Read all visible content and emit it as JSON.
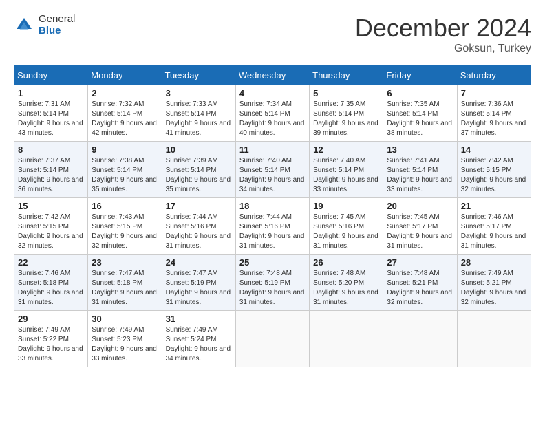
{
  "logo": {
    "general": "General",
    "blue": "Blue"
  },
  "title": "December 2024",
  "location": "Goksun, Turkey",
  "days_header": [
    "Sunday",
    "Monday",
    "Tuesday",
    "Wednesday",
    "Thursday",
    "Friday",
    "Saturday"
  ],
  "weeks": [
    [
      {
        "day": "1",
        "sunrise": "7:31 AM",
        "sunset": "5:14 PM",
        "daylight": "9 hours and 43 minutes."
      },
      {
        "day": "2",
        "sunrise": "7:32 AM",
        "sunset": "5:14 PM",
        "daylight": "9 hours and 42 minutes."
      },
      {
        "day": "3",
        "sunrise": "7:33 AM",
        "sunset": "5:14 PM",
        "daylight": "9 hours and 41 minutes."
      },
      {
        "day": "4",
        "sunrise": "7:34 AM",
        "sunset": "5:14 PM",
        "daylight": "9 hours and 40 minutes."
      },
      {
        "day": "5",
        "sunrise": "7:35 AM",
        "sunset": "5:14 PM",
        "daylight": "9 hours and 39 minutes."
      },
      {
        "day": "6",
        "sunrise": "7:35 AM",
        "sunset": "5:14 PM",
        "daylight": "9 hours and 38 minutes."
      },
      {
        "day": "7",
        "sunrise": "7:36 AM",
        "sunset": "5:14 PM",
        "daylight": "9 hours and 37 minutes."
      }
    ],
    [
      {
        "day": "8",
        "sunrise": "7:37 AM",
        "sunset": "5:14 PM",
        "daylight": "9 hours and 36 minutes."
      },
      {
        "day": "9",
        "sunrise": "7:38 AM",
        "sunset": "5:14 PM",
        "daylight": "9 hours and 35 minutes."
      },
      {
        "day": "10",
        "sunrise": "7:39 AM",
        "sunset": "5:14 PM",
        "daylight": "9 hours and 35 minutes."
      },
      {
        "day": "11",
        "sunrise": "7:40 AM",
        "sunset": "5:14 PM",
        "daylight": "9 hours and 34 minutes."
      },
      {
        "day": "12",
        "sunrise": "7:40 AM",
        "sunset": "5:14 PM",
        "daylight": "9 hours and 33 minutes."
      },
      {
        "day": "13",
        "sunrise": "7:41 AM",
        "sunset": "5:14 PM",
        "daylight": "9 hours and 33 minutes."
      },
      {
        "day": "14",
        "sunrise": "7:42 AM",
        "sunset": "5:15 PM",
        "daylight": "9 hours and 32 minutes."
      }
    ],
    [
      {
        "day": "15",
        "sunrise": "7:42 AM",
        "sunset": "5:15 PM",
        "daylight": "9 hours and 32 minutes."
      },
      {
        "day": "16",
        "sunrise": "7:43 AM",
        "sunset": "5:15 PM",
        "daylight": "9 hours and 32 minutes."
      },
      {
        "day": "17",
        "sunrise": "7:44 AM",
        "sunset": "5:16 PM",
        "daylight": "9 hours and 31 minutes."
      },
      {
        "day": "18",
        "sunrise": "7:44 AM",
        "sunset": "5:16 PM",
        "daylight": "9 hours and 31 minutes."
      },
      {
        "day": "19",
        "sunrise": "7:45 AM",
        "sunset": "5:16 PM",
        "daylight": "9 hours and 31 minutes."
      },
      {
        "day": "20",
        "sunrise": "7:45 AM",
        "sunset": "5:17 PM",
        "daylight": "9 hours and 31 minutes."
      },
      {
        "day": "21",
        "sunrise": "7:46 AM",
        "sunset": "5:17 PM",
        "daylight": "9 hours and 31 minutes."
      }
    ],
    [
      {
        "day": "22",
        "sunrise": "7:46 AM",
        "sunset": "5:18 PM",
        "daylight": "9 hours and 31 minutes."
      },
      {
        "day": "23",
        "sunrise": "7:47 AM",
        "sunset": "5:18 PM",
        "daylight": "9 hours and 31 minutes."
      },
      {
        "day": "24",
        "sunrise": "7:47 AM",
        "sunset": "5:19 PM",
        "daylight": "9 hours and 31 minutes."
      },
      {
        "day": "25",
        "sunrise": "7:48 AM",
        "sunset": "5:19 PM",
        "daylight": "9 hours and 31 minutes."
      },
      {
        "day": "26",
        "sunrise": "7:48 AM",
        "sunset": "5:20 PM",
        "daylight": "9 hours and 31 minutes."
      },
      {
        "day": "27",
        "sunrise": "7:48 AM",
        "sunset": "5:21 PM",
        "daylight": "9 hours and 32 minutes."
      },
      {
        "day": "28",
        "sunrise": "7:49 AM",
        "sunset": "5:21 PM",
        "daylight": "9 hours and 32 minutes."
      }
    ],
    [
      {
        "day": "29",
        "sunrise": "7:49 AM",
        "sunset": "5:22 PM",
        "daylight": "9 hours and 33 minutes."
      },
      {
        "day": "30",
        "sunrise": "7:49 AM",
        "sunset": "5:23 PM",
        "daylight": "9 hours and 33 minutes."
      },
      {
        "day": "31",
        "sunrise": "7:49 AM",
        "sunset": "5:24 PM",
        "daylight": "9 hours and 34 minutes."
      },
      null,
      null,
      null,
      null
    ]
  ]
}
